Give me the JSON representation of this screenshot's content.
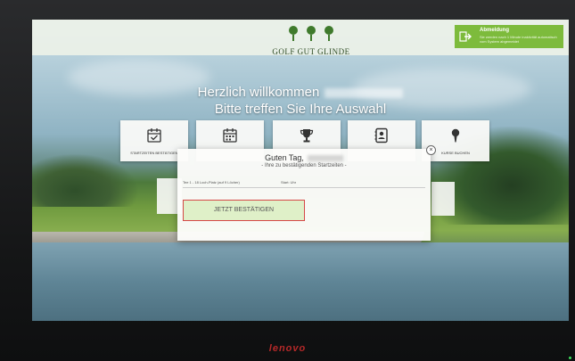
{
  "header": {
    "logo_text": "GOLF GUT GLINDE",
    "logout": {
      "title": "Abmeldung",
      "subtitle": "Sie werden nach 1 Minute inaktivität automatisch vom System abgemeldet"
    }
  },
  "welcome": {
    "line1": "Herzlich willkommen",
    "line2": "Bitte treffen Sie Ihre Auswahl"
  },
  "tiles": [
    {
      "label": "STARTZEITEN BESTÄTIGEN",
      "icon": "calendar-check-icon"
    },
    {
      "label": "",
      "icon": "calendar-icon"
    },
    {
      "label": "",
      "icon": "trophy-icon"
    },
    {
      "label": "",
      "icon": "contact-book-icon"
    },
    {
      "label": "KURSE BUCHEN",
      "icon": "golf-tee-icon"
    }
  ],
  "modal": {
    "title": "Guten Tag,",
    "subtitle": "- Ihre zu bestätigenden Startzeiten -",
    "row": {
      "col1": "Tee 1 - 18 Loch-Platz (auf 9 Löcher)",
      "col2": "Start: Uhr"
    },
    "confirm_label": "JETZT BESTÄTIGEN"
  },
  "device": {
    "brand": "lenovo"
  },
  "colors": {
    "accent": "#7dbb3c",
    "highlight_border": "#d64848",
    "brand": "#b62929"
  }
}
